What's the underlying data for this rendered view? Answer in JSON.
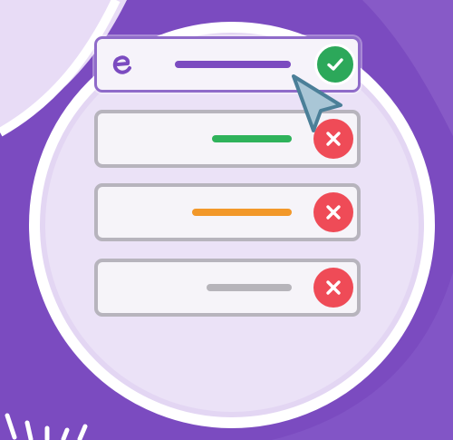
{
  "icons": {
    "logo": "e-logo-icon",
    "selected_status": "check-icon",
    "rejected_status": "close-icon",
    "pointer": "mouse-cursor-icon"
  },
  "options": [
    {
      "state": "selected",
      "bar_color": "#7b4bc0",
      "status": "check"
    },
    {
      "state": "rejected",
      "bar_color": "#2fb25b",
      "status": "x"
    },
    {
      "state": "rejected",
      "bar_color": "#f2982a",
      "status": "x"
    },
    {
      "state": "rejected",
      "bar_color": "#b6b4ba",
      "status": "x"
    }
  ],
  "colors": {
    "background": "#7b4bc0",
    "accent_purple": "#7b4bc0",
    "check_green": "#2ca85a",
    "reject_red": "#ef4b57",
    "card_fill": "#f6f4f9",
    "card_border": "#b7b4bd",
    "cursor_fill": "#a9c6d6"
  }
}
